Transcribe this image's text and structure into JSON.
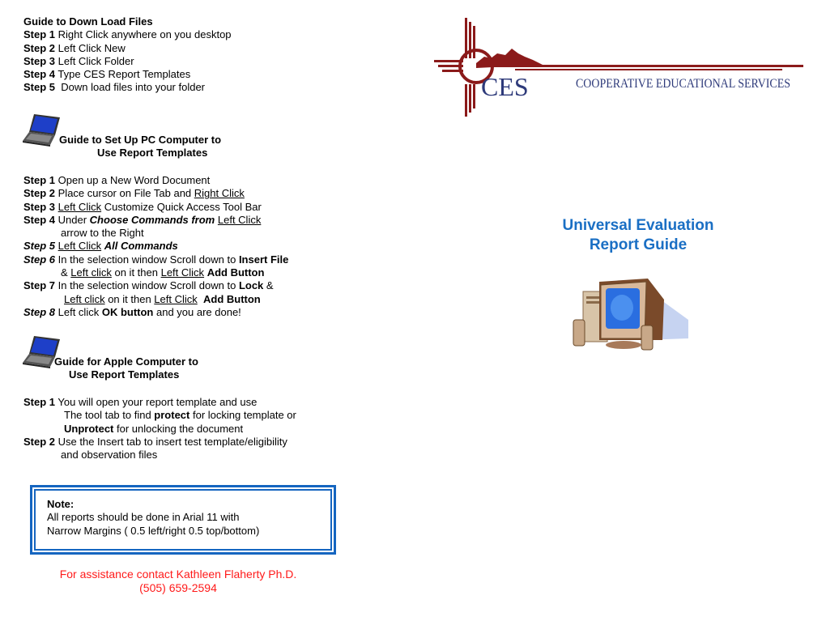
{
  "download_guide": {
    "heading": "Guide to Down Load Files",
    "steps": [
      {
        "label": "Step 1",
        "text": "Right Click anywhere on you desktop"
      },
      {
        "label": "Step 2",
        "text": "Left Click New"
      },
      {
        "label": "Step 3",
        "text": "Left Click Folder"
      },
      {
        "label": "Step 4",
        "text": "Type CES Report Templates"
      },
      {
        "label": "Step 5",
        "text": " Down load files into your folder"
      }
    ]
  },
  "pc_guide": {
    "icon": "laptop-icon",
    "heading_line1": "Guide to Set Up PC Computer to",
    "heading_line2": "Use Report Templates",
    "steps": {
      "s1": {
        "label": "Step 1",
        "text": "Open up a New Word Document"
      },
      "s2": {
        "label": "Step 2",
        "text": "Place cursor on File Tab and ",
        "u1": "Right Click"
      },
      "s3": {
        "label": "Step 3",
        "u1": "Left Click",
        "text": " Customize Quick Access Tool Bar"
      },
      "s4": {
        "label": "Step 4",
        "text": "Under ",
        "bi": "Choose Commands from",
        "u1": "Left Click",
        "cont": "arrow to the Right"
      },
      "s5": {
        "label": "Step 5",
        "u1": "Left Click",
        "bi": "All Commands"
      },
      "s6": {
        "label": "Step 6",
        "text": "In the selection window Scroll down to ",
        "b1": "Insert File",
        "c_amp": "& ",
        "c_u1": "Left click",
        "c_mid": " on it then ",
        "c_u2": "Left Click",
        "c_b": "Add Button"
      },
      "s7": {
        "label": "Step 7",
        "text": "In the selection window Scroll down to ",
        "b1": "Lock",
        "amp": " &",
        "c_u1": "Left click",
        "c_mid": " on it then ",
        "c_u2": "Left Click",
        "c_b": "Add Button"
      },
      "s8": {
        "label": "Step 8",
        "text": "Left click ",
        "b1": "OK button",
        "tail": " and you are done!"
      }
    }
  },
  "apple_guide": {
    "icon": "laptop-icon",
    "heading_line1": "Guide for Apple Computer to",
    "heading_line2": "Use Report Templates",
    "steps": {
      "s1": {
        "label": "Step 1",
        "text": "You will open your report template and use",
        "l2a": "The tool tab to find ",
        "l2b": "protect",
        "l2c": " for locking template or",
        "l3a": "Unprotect",
        "l3b": " for unlocking the document"
      },
      "s2": {
        "label": "Step 2",
        "text": "Use the Insert tab to insert test template/eligibility",
        "l2": "and observation files"
      }
    }
  },
  "note": {
    "label": "Note:",
    "line1": "All reports should be done in Arial 11 with",
    "line2": "Narrow Margins ( 0.5 left/right 0.5 top/bottom)",
    "border_color": "#1565c0"
  },
  "contact": {
    "line1": "For assistance contact Kathleen Flaherty Ph.D.",
    "line2": "(505) 659-2594",
    "color": "#ff1a1a"
  },
  "logo": {
    "abbr": "CES",
    "name": "COOPERATIVE EDUCATIONAL SERVICES",
    "red": "#8b1a1a",
    "navy": "#2e3a7a"
  },
  "title": {
    "line1": "Universal Evaluation",
    "line2": "Report Guide",
    "color": "#1a6fc4"
  },
  "illustration": "desktop-computer-icon"
}
